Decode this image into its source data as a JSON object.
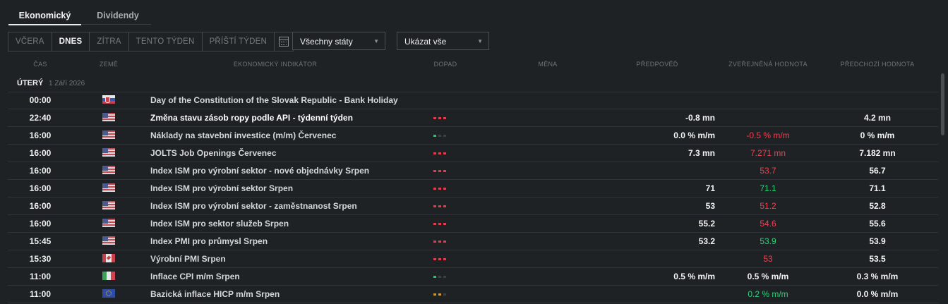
{
  "tabs": [
    "Ekonomický",
    "Dividendy"
  ],
  "day_buttons": [
    "VČERA",
    "DNES",
    "ZÍTRA",
    "TENTO TÝDEN",
    "PŘÍŠTÍ TÝDEN"
  ],
  "active_day": "DNES",
  "filters": {
    "country": "Všechny státy",
    "impact": "Ukázat vše"
  },
  "columns": {
    "time": "ČAS",
    "country": "ZEMĚ",
    "indicator": "EKONOMICKÝ INDIKÁTOR",
    "impact": "DOPAD",
    "currency": "MĚNA",
    "forecast": "PŘEDPOVĚĎ",
    "actual": "ZVEŘEJNĚNÁ HODNOTA",
    "previous": "PŘEDCHOZÍ HODNOTA"
  },
  "day_header": {
    "day": "ÚTERÝ",
    "date": "1 Září 2026"
  },
  "rows": [
    {
      "time": "00:00",
      "flag": "sk-flag-icon",
      "indicator": "Day of the Constitution of the Slovak Republic - Bank Holiday",
      "impact": [],
      "forecast": "",
      "actual": "",
      "actual_color": "",
      "previous": ""
    },
    {
      "time": "22:40",
      "flag": "us-flag-icon",
      "indicator": "Změna stavu zásob ropy podle API - týdenní týden",
      "strong": true,
      "impact": [
        "r",
        "r",
        "r"
      ],
      "forecast": "-0.8 mn",
      "actual": "",
      "actual_color": "",
      "previous": "4.2 mn"
    },
    {
      "time": "16:00",
      "flag": "us-flag-icon",
      "indicator": "Náklady na stavební investice (m/m) Červenec",
      "impact": [
        "g",
        "off",
        "off"
      ],
      "forecast": "0.0 % m/m",
      "actual": "-0.5 % m/m",
      "actual_color": "red",
      "previous": "0 % m/m"
    },
    {
      "time": "16:00",
      "flag": "us-flag-icon",
      "indicator": "JOLTS Job Openings Červenec",
      "impact": [
        "r",
        "r",
        "r"
      ],
      "forecast": "7.3 mn",
      "actual": "7.271 mn",
      "actual_color": "red",
      "previous": "7.182 mn"
    },
    {
      "time": "16:00",
      "flag": "us-flag-icon",
      "indicator": "Index ISM pro výrobní sektor - nové objednávky Srpen",
      "impact": [
        "r",
        "r",
        "r"
      ],
      "forecast": "",
      "actual": "53.7",
      "actual_color": "red",
      "previous": "56.7"
    },
    {
      "time": "16:00",
      "flag": "us-flag-icon",
      "indicator": "Index ISM pro výrobní sektor Srpen",
      "impact": [
        "r",
        "r",
        "r"
      ],
      "forecast": "71",
      "actual": "71.1",
      "actual_color": "green",
      "previous": "71.1"
    },
    {
      "time": "16:00",
      "flag": "us-flag-icon",
      "indicator": "Index ISM pro výrobní sektor - zaměstnanost Srpen",
      "impact": [
        "r",
        "r",
        "r"
      ],
      "forecast": "53",
      "actual": "51.2",
      "actual_color": "red",
      "previous": "52.8"
    },
    {
      "time": "16:00",
      "flag": "us-flag-icon",
      "indicator": "Index ISM pro sektor služeb Srpen",
      "impact": [
        "r",
        "r",
        "r"
      ],
      "forecast": "55.2",
      "actual": "54.6",
      "actual_color": "red",
      "previous": "55.6"
    },
    {
      "time": "15:45",
      "flag": "us-flag-icon",
      "indicator": "Index PMI pro průmysl Srpen",
      "impact": [
        "r",
        "r",
        "r"
      ],
      "forecast": "53.2",
      "actual": "53.9",
      "actual_color": "green",
      "previous": "53.9"
    },
    {
      "time": "15:30",
      "flag": "ca-flag-icon",
      "indicator": "Výrobní PMI Srpen",
      "impact": [
        "r",
        "r",
        "r"
      ],
      "forecast": "",
      "actual": "53",
      "actual_color": "red",
      "previous": "53.5"
    },
    {
      "time": "11:00",
      "flag": "it-flag-icon",
      "indicator": "Inflace CPI m/m Srpen",
      "impact": [
        "g",
        "off",
        "off"
      ],
      "forecast": "0.5 % m/m",
      "actual": "0.5 % m/m",
      "actual_color": "white",
      "previous": "0.3 % m/m"
    },
    {
      "time": "11:00",
      "flag": "eu-flag-icon",
      "indicator": "Bazická inflace HICP m/m Srpen",
      "impact": [
        "o",
        "o",
        "off"
      ],
      "forecast": "",
      "actual": "0.2 % m/m",
      "actual_color": "green",
      "previous": "0.0 % m/m"
    }
  ],
  "colors": {
    "background": "#1f2225",
    "negative": "#f0414f",
    "positive": "#2fd17a",
    "high_impact": "#e23b4a",
    "low_impact": "#27c36d",
    "medium_impact": "#c99a3a"
  }
}
